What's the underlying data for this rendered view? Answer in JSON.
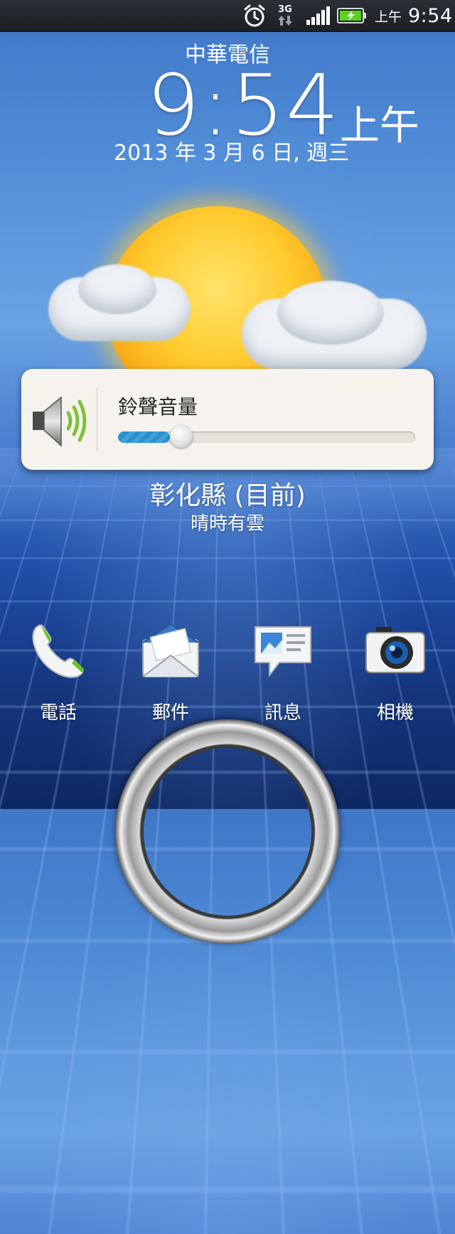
{
  "status_bar": {
    "network_type": "3G",
    "ampm": "上午",
    "time": "9:54"
  },
  "lockscreen": {
    "carrier": "中華電信",
    "clock": "9:54",
    "ampm": "上午",
    "date": "2013 年 3 月 6 日, 週三"
  },
  "volume_panel": {
    "title": "鈴聲音量",
    "level_fraction": 0.14
  },
  "weather": {
    "location": "彰化縣 (目前)",
    "condition": "晴時有雲"
  },
  "shortcuts": [
    {
      "label": "電話",
      "icon": "phone-icon"
    },
    {
      "label": "郵件",
      "icon": "mail-icon"
    },
    {
      "label": "訊息",
      "icon": "messages-icon"
    },
    {
      "label": "相機",
      "icon": "camera-icon"
    }
  ],
  "colors": {
    "slider_fill": "#3ea2db",
    "battery_green": "#5bd41f",
    "speaker_wave_green": "#7cc23a"
  }
}
